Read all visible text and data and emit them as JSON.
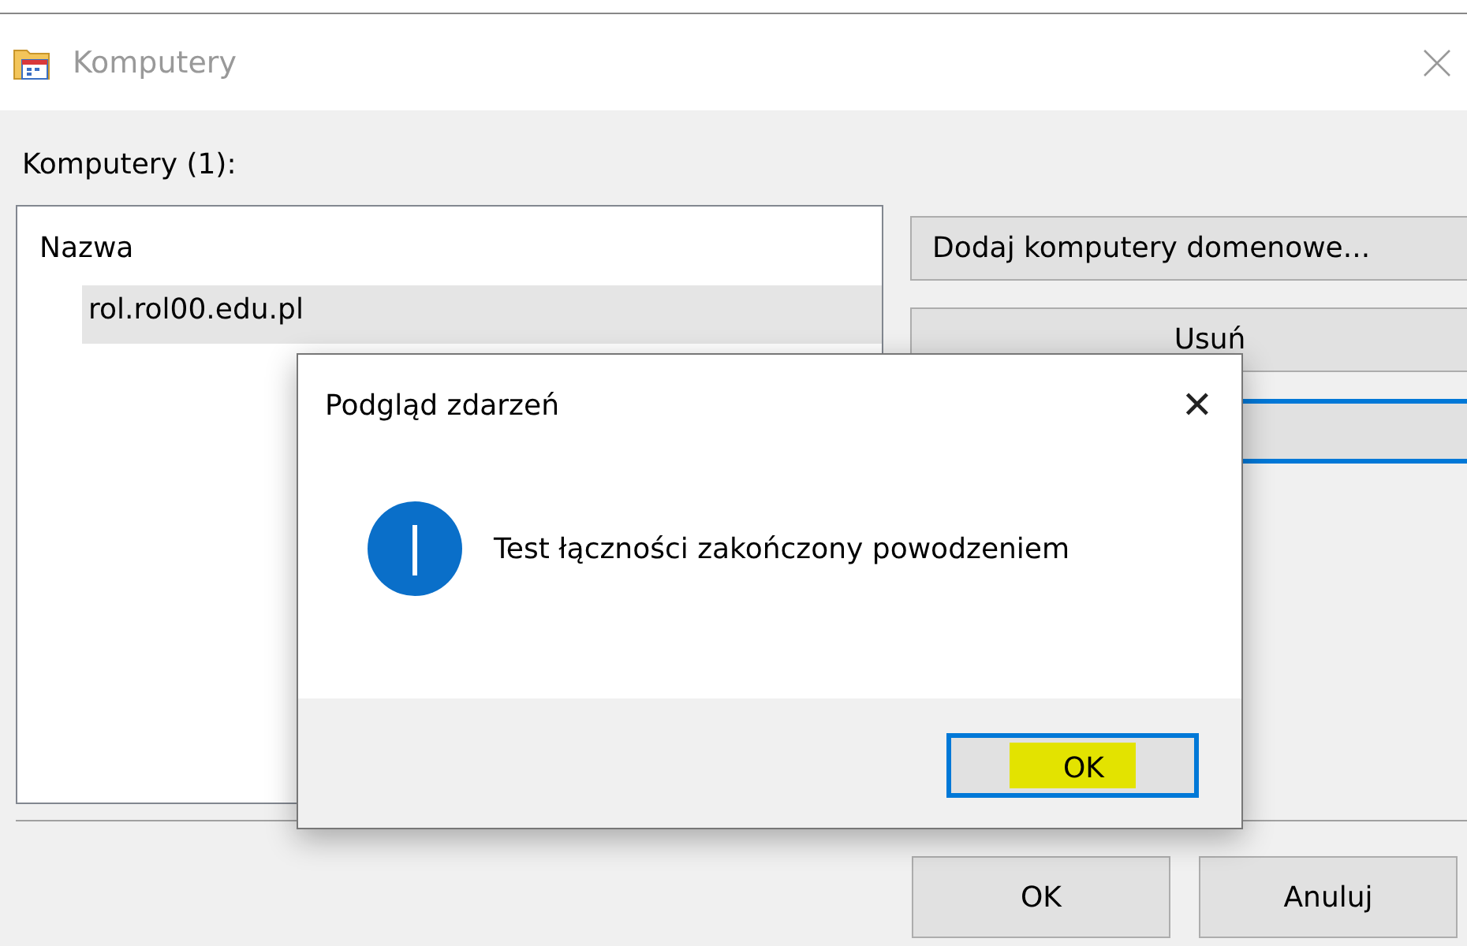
{
  "window": {
    "title": "Komputery"
  },
  "list_label": "Komputery (1):",
  "list": {
    "column": "Nazwa",
    "items": [
      {
        "label": "rol.rol00.edu.pl",
        "selected": true
      }
    ]
  },
  "side_buttons": [
    {
      "label": "Dodaj komputery domenowe...",
      "focused": false
    },
    {
      "label": "Usuń",
      "focused": false
    },
    {
      "focused": true
    }
  ],
  "footer_buttons": [
    {
      "label": "OK"
    },
    {
      "label": "Anuluj"
    }
  ],
  "dialog": {
    "title": "Podgląd zdarzeń",
    "close": "✕",
    "message": "Test łączności zakończony powodzeniem",
    "button": {
      "label": "OK",
      "focused": true,
      "highlighted": true
    }
  }
}
